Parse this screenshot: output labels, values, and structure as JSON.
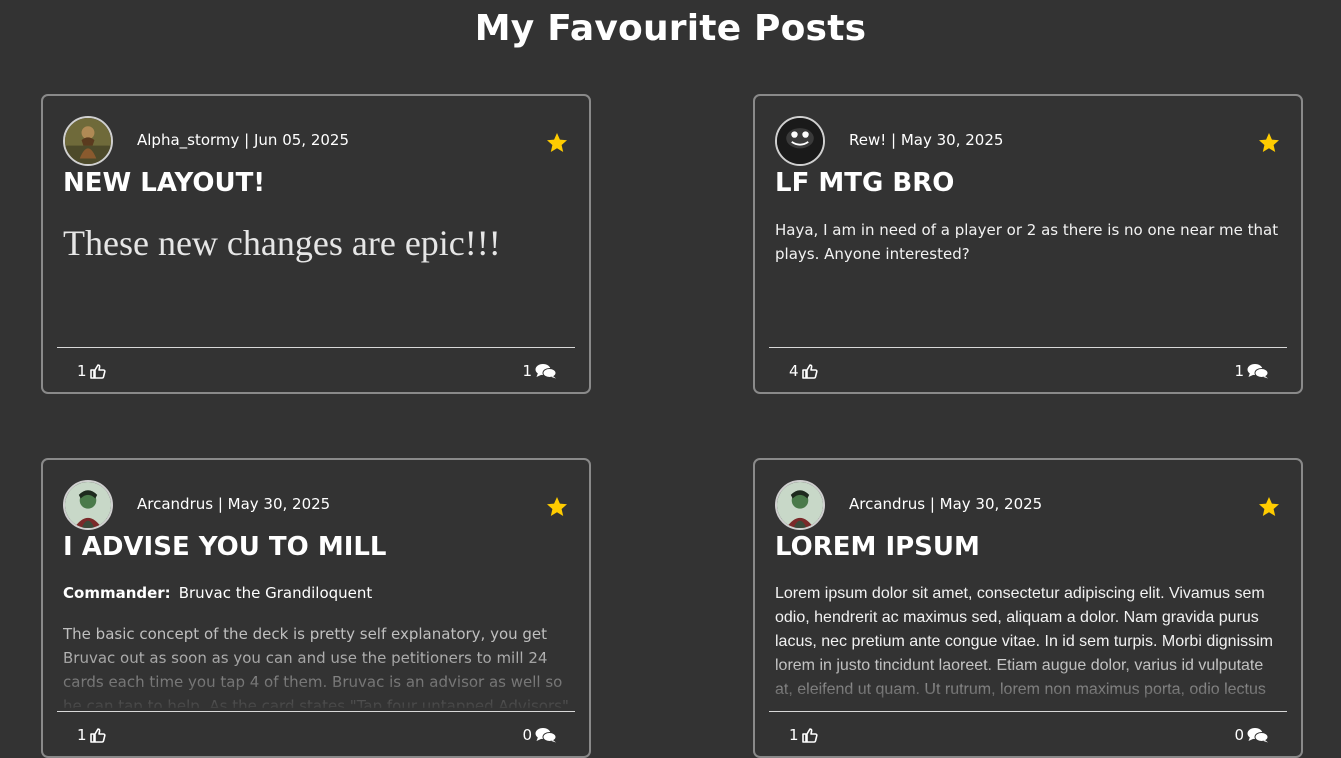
{
  "page": {
    "title": "My Favourite Posts"
  },
  "colors": {
    "background": "#333333",
    "star": "#ffcc00",
    "border": "#8a8a8a"
  },
  "posts": [
    {
      "meta": "Alpha_stormy | Jun 05, 2025",
      "title": "NEW LAYOUT!",
      "body": "These new changes are epic!!!",
      "likes": "1",
      "comments": "1"
    },
    {
      "meta": "Rew! | May 30, 2025",
      "title": "LF MTG BRO",
      "body": "Haya, I am in need of a player or 2 as there is no one near me that plays. Anyone interested?",
      "likes": "4",
      "comments": "1"
    },
    {
      "meta": "Arcandrus | May 30, 2025",
      "title": "I ADVISE YOU TO MILL",
      "commander_label": "Commander:",
      "commander_value": "Bruvac the Grandiloquent",
      "body": "The basic concept of the deck is pretty self explanatory, you get Bruvac out as soon as you can and use the petitioners to mill 24 cards each time you tap 4 of them. Bruvac is an advisor as well so he can tap to help. As the card states \"Tap four untapped Advisors\" this wording",
      "likes": "1",
      "comments": "0"
    },
    {
      "meta": "Arcandrus | May 30, 2025",
      "title": "LOREM IPSUM",
      "body": "Lorem ipsum dolor sit amet, consectetur adipiscing elit. Vivamus sem odio, hendrerit ac maximus sed, aliquam a dolor. Nam gravida purus lacus, nec pretium ante congue vitae. In id sem turpis. Morbi dignissim lorem in justo tincidunt laoreet. Etiam augue dolor, varius id vulputate at, eleifend ut quam. Ut rutrum, lorem non maximus porta, odio lectus",
      "likes": "1",
      "comments": "0"
    }
  ]
}
